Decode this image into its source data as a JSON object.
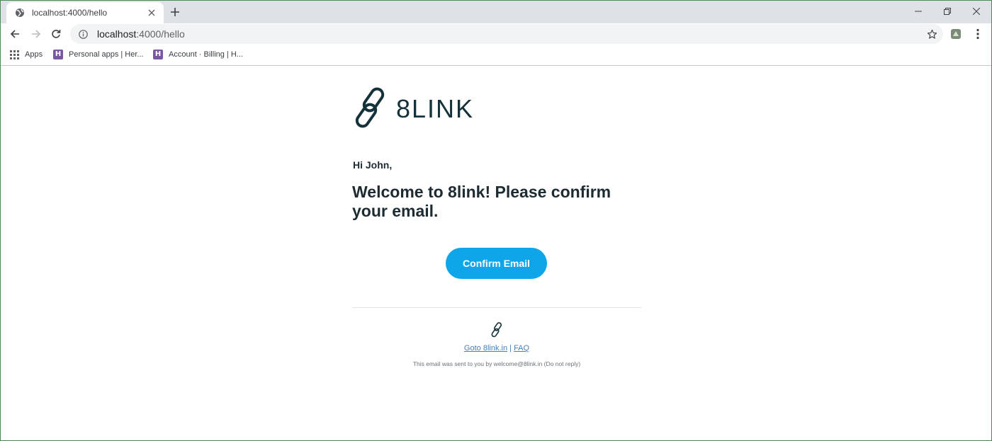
{
  "browser": {
    "tab": {
      "title": "localhost:4000/hello",
      "favicon": "globe-icon"
    },
    "window_controls": [
      "minimize",
      "restore",
      "close"
    ],
    "address_bar": {
      "host": "localhost",
      "path": ":4000/hello"
    },
    "bookmarks": [
      {
        "label": "Apps",
        "icon": "apps-grid-icon"
      },
      {
        "label": "Personal apps | Her...",
        "icon": "heroku-icon"
      },
      {
        "label": "Account · Billing | H...",
        "icon": "heroku-icon"
      }
    ]
  },
  "email": {
    "brand": "8LINK",
    "greeting": "Hi John,",
    "headline": "Welcome to 8link! Please confirm your email.",
    "cta_label": "Confirm Email",
    "footer": {
      "link_site": "Goto 8link.in",
      "separator": "|",
      "link_faq": "FAQ",
      "note": "This email was sent to you by welcome@8link.in (Do not reply)"
    }
  },
  "colors": {
    "brand_dark": "#15323b",
    "cta": "#0ea6e9",
    "link": "#4a7fb5"
  }
}
